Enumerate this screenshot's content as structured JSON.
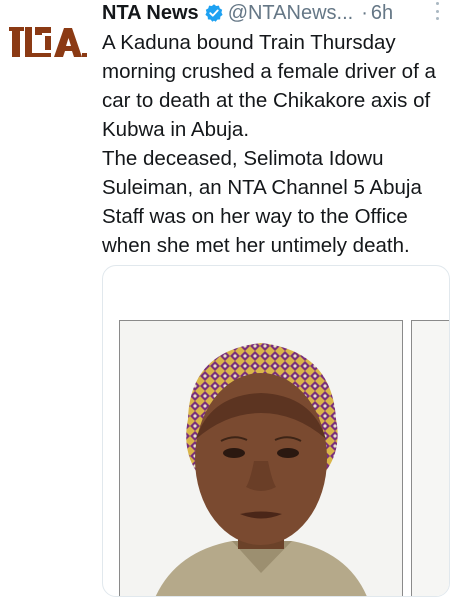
{
  "account": {
    "logo_text": "NTA",
    "name": "NTA News",
    "handle": "@NTANews...",
    "separator": "·",
    "time": "6h",
    "verified_color": "#1da1f2"
  },
  "tweet": {
    "paragraph1": "A Kaduna bound Train Thursday morning crushed a female driver of a car to death at the Chikakore axis of Kubwa in Abuja.",
    "paragraph2": "The deceased, Selimota Idowu Suleiman, an NTA Channel 5 Abuja Staff was on her way to the Office when she met her untimely death."
  },
  "icons": {
    "verified": "verified-badge-icon",
    "more": "more-vertical-icon"
  },
  "colors": {
    "logo": "#8b3a14",
    "text": "#14171a",
    "muted": "#657786",
    "card_border": "#e1e8ed"
  }
}
